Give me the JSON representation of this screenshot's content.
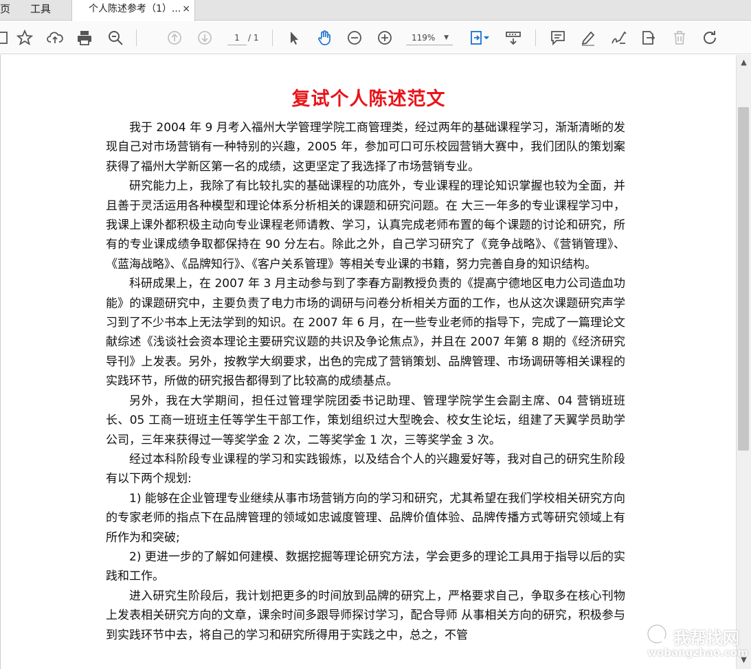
{
  "tabs": {
    "home": "页",
    "tools": "工具",
    "document": "个人陈述参考（1）...",
    "close": "×"
  },
  "toolbar": {
    "page_current": "1",
    "page_total": "/ 1",
    "zoom": "119%",
    "icons": [
      "bookmark-star-icon",
      "upload-cloud-icon",
      "print-icon",
      "search-zoom-icon",
      "page-up-icon",
      "page-down-icon",
      "select-arrow-icon",
      "hand-tool-icon",
      "zoom-out-icon",
      "zoom-in-icon",
      "fit-page-icon",
      "read-mode-icon",
      "comment-icon",
      "highlight-pen-icon",
      "sign-icon",
      "share-edit-icon",
      "delete-icon",
      "rotate-icon"
    ]
  },
  "document": {
    "title": "复试个人陈述范文",
    "paragraphs": [
      "我于 2004 年 9 月考入福州大学管理学院工商管理类，经过两年的基础课程学习，渐渐清晰的发现自己对市场营销有一种特别的兴趣，2005 年，参加可口可乐校园营销大赛中，我们团队的策划案获得了福州大学新区第一名的成绩，这更坚定了我选择了市场营销专业。",
      "研究能力上，我除了有比较扎实的基础课程的功底外，专业课程的理论知识掌握也较为全面，并且善于灵活运用各种模型和理论体系分析相关的课题和研究问题。在 大三一年多的专业课程学习中，我课上课外都积极主动向专业课程老师请教、学习，认真完成老师布置的每个课题的讨论和研究，所有的专业课成绩争取都保持在 90 分左右。除此之外，自己学习研究了《竞争战略》、《营销管理》、《蓝海战略》、《品牌知行》、《客户关系管理》等相关专业课的书籍，努力完善自身的知识结构。",
      "科研成果上，在 2007 年 3 月主动参与到了李春方副教授负责的《提高宁德地区电力公司造血功能》的课题研究中，主要负责了电力市场的调研与问卷分析相关方面的工作，也从这次课题研究声学习到了不少书本上无法学到的知识。在 2007 年 6 月，在一些专业老师的指导下，完成了一篇理论文献综述《浅谈社会资本理论主要研究议题的共识及争论焦点》，并且在 2007 年第 8 期的《经济研究导刊》上发表。另外，按教学大纲要求，出色的完成了营销策划、品牌管理、市场调研等相关课程的实践环节，所做的研究报告都得到了比较高的成绩基点。",
      "另外，我在大学期间，担任过管理学院团委书记助理、管理学院学生会副主席、04 营销班班长、05 工商一班班主任等学生干部工作，策划组织过大型晚会、校女生论坛，组建了天翼学员助学公司，三年来获得过一等奖学金 2 次，二等奖学金 1 次，三等奖学金 3 次。",
      "经过本科阶段专业课程的学习和实践锻炼，以及结合个人的兴趣爱好等，我对自己的研究生阶段有以下两个规划:",
      "1) 能够在企业管理专业继续从事市场营销方向的学习和研究，尤其希望在我们学校相关研究方向的专家老师的指点下在品牌管理的领域如忠诚度管理、品牌价值体验、品牌传播方式等研究领域上有所作为和突破;",
      "2) 更进一步的了解如何建模、数据挖掘等理论研究方法，学会更多的理论工具用于指导以后的实践和工作。",
      "进入研究生阶段后，我计划把更多的时间放到品牌的研究上，严格要求自己，争取多在核心刊物上发表相关研究方向的文章，课余时间多跟导师探讨学习，配合导师 从事相关方向的研究，积极参与到实践环节中去，将自己的学习和研究所得用于实践之中，总之，不管"
    ]
  },
  "watermark": {
    "brand": "我帮找网",
    "url": "wobangzhao.com"
  }
}
